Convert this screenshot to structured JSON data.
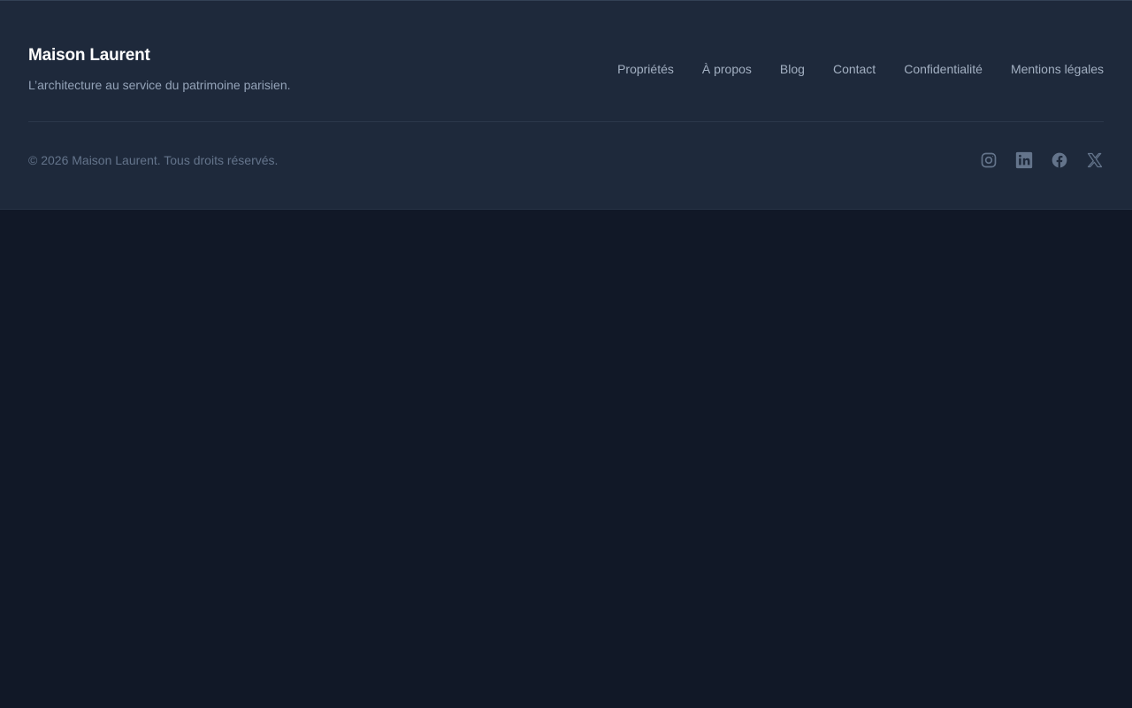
{
  "brand": {
    "name": "Maison Laurent",
    "tagline": "L’architecture au service du patrimoine parisien."
  },
  "nav": {
    "items": [
      {
        "label": "Propriétés"
      },
      {
        "label": "À propos"
      },
      {
        "label": "Blog"
      },
      {
        "label": "Contact"
      },
      {
        "label": "Confidentialité"
      },
      {
        "label": "Mentions légales"
      }
    ]
  },
  "footer": {
    "copyright": "© 2026 Maison Laurent. Tous droits réservés."
  },
  "social": {
    "icons": [
      "instagram-icon",
      "linkedin-icon",
      "facebook-icon",
      "x-icon"
    ]
  },
  "colors": {
    "page_background": "#111827",
    "footer_background": "#1e293b",
    "icon_color": "#64748b"
  }
}
